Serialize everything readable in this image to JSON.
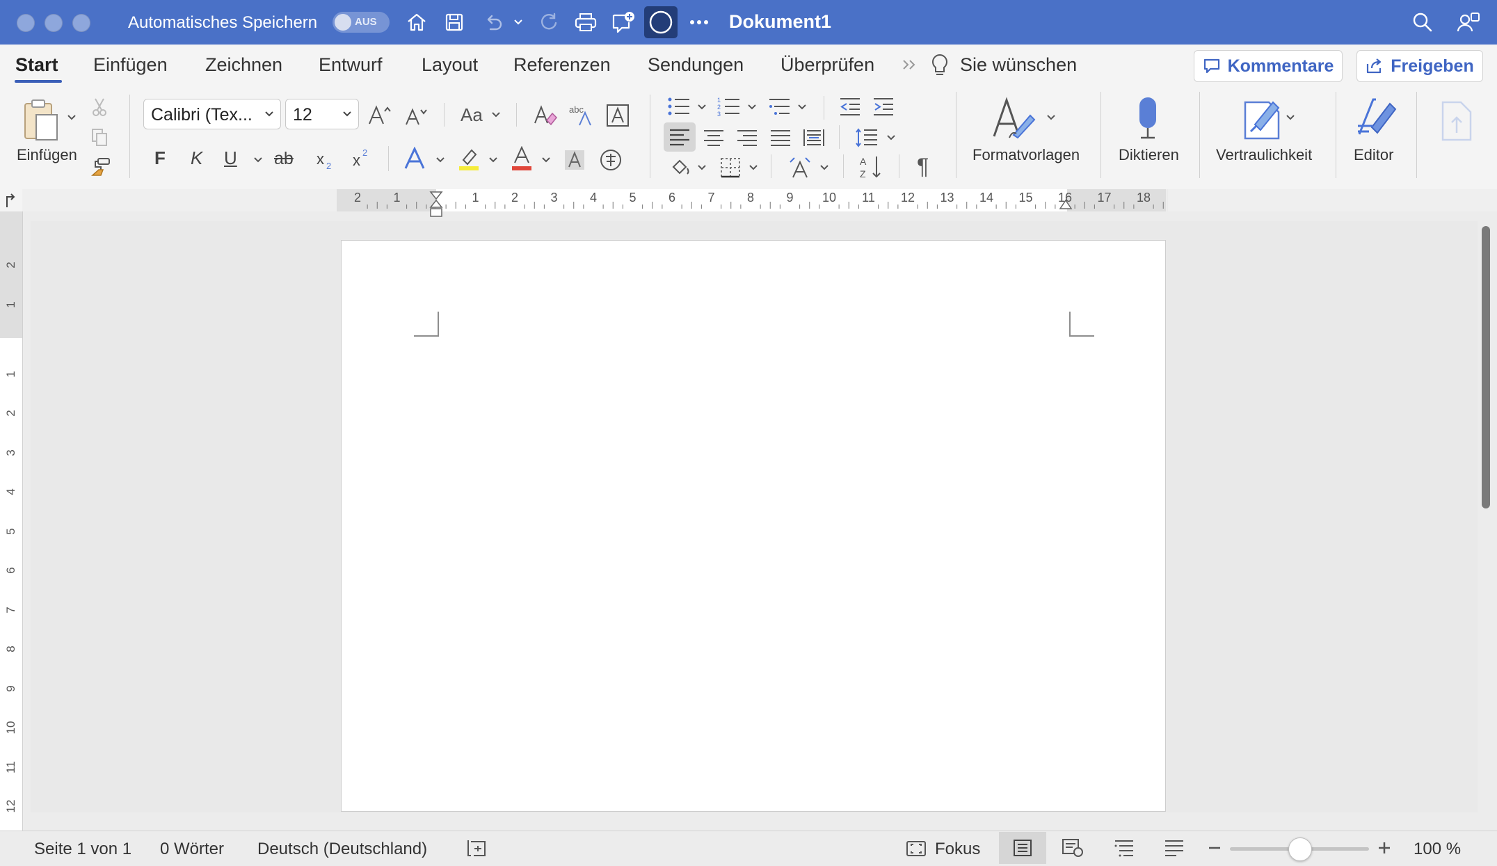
{
  "titlebar": {
    "autosave_label": "Automatisches Speichern",
    "autosave_state": "AUS",
    "document_title": "Dokument1",
    "accent_color": "#4a71c7"
  },
  "tabs": [
    {
      "label": "Start"
    },
    {
      "label": "Einfügen"
    },
    {
      "label": "Zeichnen"
    },
    {
      "label": "Entwurf"
    },
    {
      "label": "Layout"
    },
    {
      "label": "Referenzen"
    },
    {
      "label": "Sendungen"
    },
    {
      "label": "Überprüfen"
    }
  ],
  "tell_me": "Sie wünschen",
  "comments_button": "Kommentare",
  "share_button": "Freigeben",
  "ribbon": {
    "paste_label": "Einfügen",
    "font_name": "Calibri (Tex...",
    "font_size": "12",
    "case_label": "Aa",
    "bold_glyph": "F",
    "italic_glyph": "K",
    "underline_glyph": "U",
    "strike_glyph": "ab",
    "styles_label": "Formatvorlagen",
    "dictate_label": "Diktieren",
    "sensitivity_label": "Vertraulichkeit",
    "editor_label": "Editor"
  },
  "ruler": {
    "h_numbers_left": [
      "2",
      "1"
    ],
    "h_numbers": [
      "1",
      "2",
      "3",
      "4",
      "5",
      "6",
      "7",
      "8",
      "9",
      "10",
      "11",
      "12",
      "13",
      "14",
      "15",
      "16",
      "17",
      "18"
    ],
    "v_numbers_top": [
      "2",
      "1"
    ],
    "v_numbers": [
      "1",
      "2",
      "3",
      "4",
      "5",
      "6",
      "7",
      "8",
      "9",
      "10",
      "11",
      "12"
    ]
  },
  "status": {
    "page": "Seite 1 von 1",
    "words": "0 Wörter",
    "language": "Deutsch (Deutschland)",
    "focus": "Fokus",
    "zoom": "100 %",
    "zoom_level": 1.0
  }
}
